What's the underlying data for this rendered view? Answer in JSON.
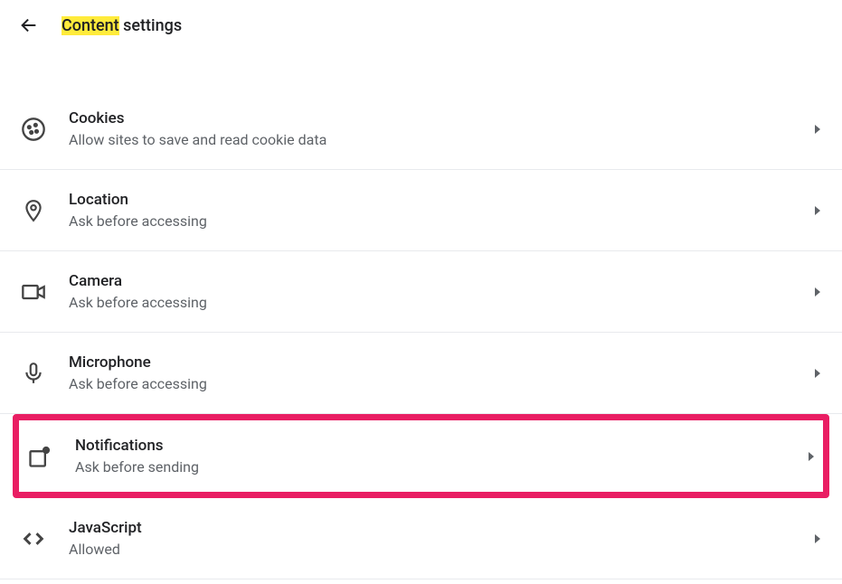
{
  "header": {
    "title_highlighted": "Content",
    "title_rest": " settings"
  },
  "settings": [
    {
      "title": "Cookies",
      "subtitle": "Allow sites to save and read cookie data"
    },
    {
      "title": "Location",
      "subtitle": "Ask before accessing"
    },
    {
      "title": "Camera",
      "subtitle": "Ask before accessing"
    },
    {
      "title": "Microphone",
      "subtitle": "Ask before accessing"
    },
    {
      "title": "Notifications",
      "subtitle": "Ask before sending"
    },
    {
      "title": "JavaScript",
      "subtitle": "Allowed"
    }
  ]
}
